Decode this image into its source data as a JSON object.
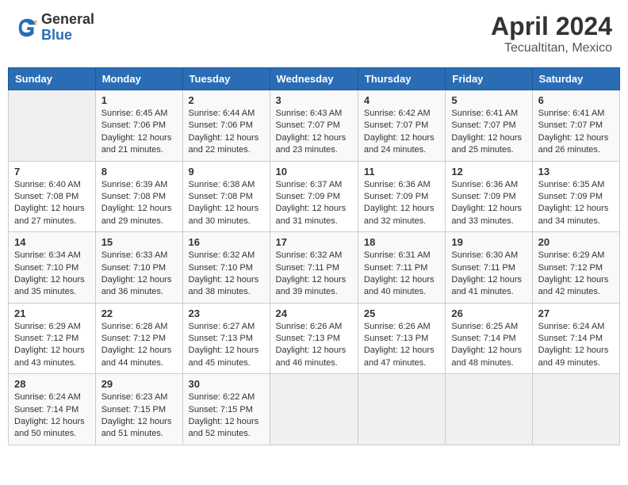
{
  "header": {
    "logo_general": "General",
    "logo_blue": "Blue",
    "month": "April 2024",
    "location": "Tecualtitan, Mexico"
  },
  "days_of_week": [
    "Sunday",
    "Monday",
    "Tuesday",
    "Wednesday",
    "Thursday",
    "Friday",
    "Saturday"
  ],
  "weeks": [
    [
      {
        "day": "",
        "info": ""
      },
      {
        "day": "1",
        "info": "Sunrise: 6:45 AM\nSunset: 7:06 PM\nDaylight: 12 hours\nand 21 minutes."
      },
      {
        "day": "2",
        "info": "Sunrise: 6:44 AM\nSunset: 7:06 PM\nDaylight: 12 hours\nand 22 minutes."
      },
      {
        "day": "3",
        "info": "Sunrise: 6:43 AM\nSunset: 7:07 PM\nDaylight: 12 hours\nand 23 minutes."
      },
      {
        "day": "4",
        "info": "Sunrise: 6:42 AM\nSunset: 7:07 PM\nDaylight: 12 hours\nand 24 minutes."
      },
      {
        "day": "5",
        "info": "Sunrise: 6:41 AM\nSunset: 7:07 PM\nDaylight: 12 hours\nand 25 minutes."
      },
      {
        "day": "6",
        "info": "Sunrise: 6:41 AM\nSunset: 7:07 PM\nDaylight: 12 hours\nand 26 minutes."
      }
    ],
    [
      {
        "day": "7",
        "info": "Sunrise: 6:40 AM\nSunset: 7:08 PM\nDaylight: 12 hours\nand 27 minutes."
      },
      {
        "day": "8",
        "info": "Sunrise: 6:39 AM\nSunset: 7:08 PM\nDaylight: 12 hours\nand 29 minutes."
      },
      {
        "day": "9",
        "info": "Sunrise: 6:38 AM\nSunset: 7:08 PM\nDaylight: 12 hours\nand 30 minutes."
      },
      {
        "day": "10",
        "info": "Sunrise: 6:37 AM\nSunset: 7:09 PM\nDaylight: 12 hours\nand 31 minutes."
      },
      {
        "day": "11",
        "info": "Sunrise: 6:36 AM\nSunset: 7:09 PM\nDaylight: 12 hours\nand 32 minutes."
      },
      {
        "day": "12",
        "info": "Sunrise: 6:36 AM\nSunset: 7:09 PM\nDaylight: 12 hours\nand 33 minutes."
      },
      {
        "day": "13",
        "info": "Sunrise: 6:35 AM\nSunset: 7:09 PM\nDaylight: 12 hours\nand 34 minutes."
      }
    ],
    [
      {
        "day": "14",
        "info": "Sunrise: 6:34 AM\nSunset: 7:10 PM\nDaylight: 12 hours\nand 35 minutes."
      },
      {
        "day": "15",
        "info": "Sunrise: 6:33 AM\nSunset: 7:10 PM\nDaylight: 12 hours\nand 36 minutes."
      },
      {
        "day": "16",
        "info": "Sunrise: 6:32 AM\nSunset: 7:10 PM\nDaylight: 12 hours\nand 38 minutes."
      },
      {
        "day": "17",
        "info": "Sunrise: 6:32 AM\nSunset: 7:11 PM\nDaylight: 12 hours\nand 39 minutes."
      },
      {
        "day": "18",
        "info": "Sunrise: 6:31 AM\nSunset: 7:11 PM\nDaylight: 12 hours\nand 40 minutes."
      },
      {
        "day": "19",
        "info": "Sunrise: 6:30 AM\nSunset: 7:11 PM\nDaylight: 12 hours\nand 41 minutes."
      },
      {
        "day": "20",
        "info": "Sunrise: 6:29 AM\nSunset: 7:12 PM\nDaylight: 12 hours\nand 42 minutes."
      }
    ],
    [
      {
        "day": "21",
        "info": "Sunrise: 6:29 AM\nSunset: 7:12 PM\nDaylight: 12 hours\nand 43 minutes."
      },
      {
        "day": "22",
        "info": "Sunrise: 6:28 AM\nSunset: 7:12 PM\nDaylight: 12 hours\nand 44 minutes."
      },
      {
        "day": "23",
        "info": "Sunrise: 6:27 AM\nSunset: 7:13 PM\nDaylight: 12 hours\nand 45 minutes."
      },
      {
        "day": "24",
        "info": "Sunrise: 6:26 AM\nSunset: 7:13 PM\nDaylight: 12 hours\nand 46 minutes."
      },
      {
        "day": "25",
        "info": "Sunrise: 6:26 AM\nSunset: 7:13 PM\nDaylight: 12 hours\nand 47 minutes."
      },
      {
        "day": "26",
        "info": "Sunrise: 6:25 AM\nSunset: 7:14 PM\nDaylight: 12 hours\nand 48 minutes."
      },
      {
        "day": "27",
        "info": "Sunrise: 6:24 AM\nSunset: 7:14 PM\nDaylight: 12 hours\nand 49 minutes."
      }
    ],
    [
      {
        "day": "28",
        "info": "Sunrise: 6:24 AM\nSunset: 7:14 PM\nDaylight: 12 hours\nand 50 minutes."
      },
      {
        "day": "29",
        "info": "Sunrise: 6:23 AM\nSunset: 7:15 PM\nDaylight: 12 hours\nand 51 minutes."
      },
      {
        "day": "30",
        "info": "Sunrise: 6:22 AM\nSunset: 7:15 PM\nDaylight: 12 hours\nand 52 minutes."
      },
      {
        "day": "",
        "info": ""
      },
      {
        "day": "",
        "info": ""
      },
      {
        "day": "",
        "info": ""
      },
      {
        "day": "",
        "info": ""
      }
    ]
  ]
}
